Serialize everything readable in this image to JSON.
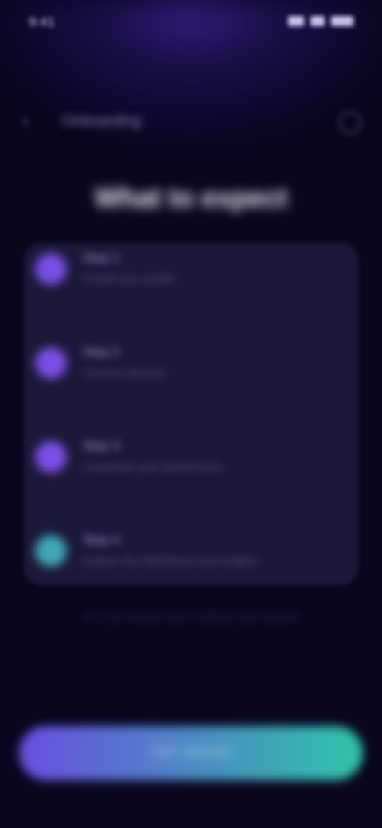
{
  "status_bar": {
    "time": "9:41"
  },
  "nav": {
    "title": "Onboarding",
    "back_icon": "chevron-left-icon",
    "help_icon": "help-circle-icon"
  },
  "headline": "What to expect",
  "items": [
    {
      "title": "Step 1",
      "subtitle": "Create your profile",
      "color": "#7b4fe6"
    },
    {
      "title": "Step 2",
      "subtitle": "Connect devices",
      "color": "#7b4fe6"
    },
    {
      "title": "Step 3",
      "subtitle": "Customize your preferences",
      "color": "#7b4fe6"
    },
    {
      "title": "Step 4",
      "subtitle": "Explore the dashboard and insights",
      "color": "#3fa8b8"
    }
  ],
  "footnote": "You can change these settings later anytime",
  "cta": {
    "label": "Get started",
    "gradient_start": "#6a4fe0",
    "gradient_end": "#2fc4a8"
  }
}
